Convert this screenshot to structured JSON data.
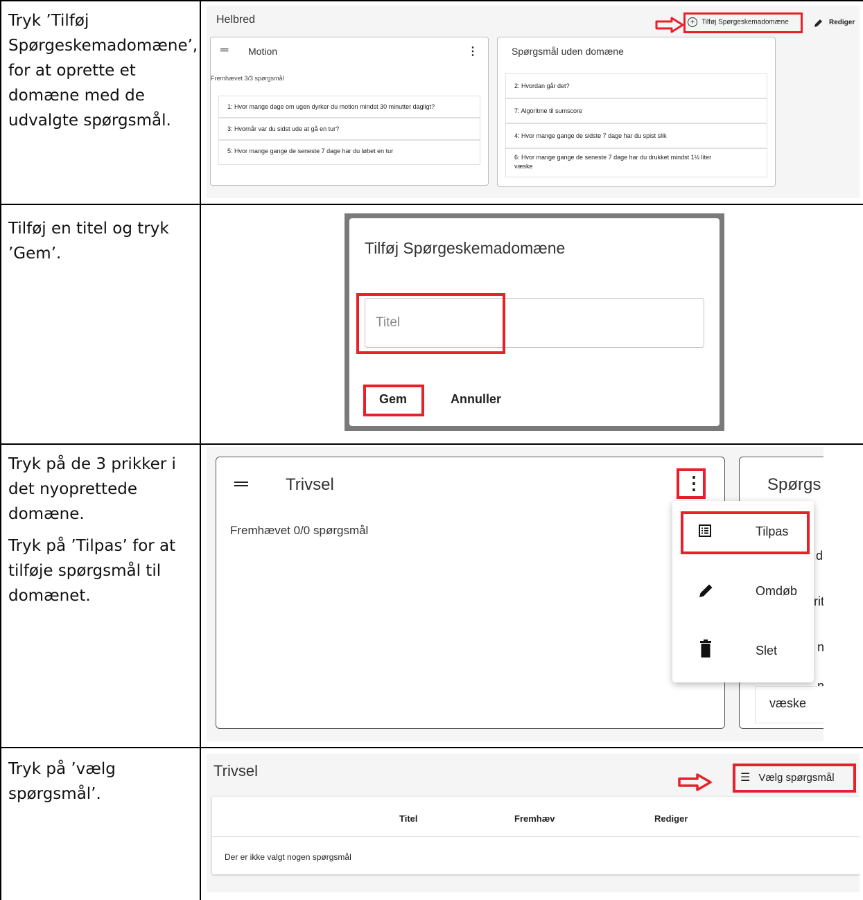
{
  "steps": [
    {
      "text": "Tryk ’Tilføj Spørgeskemadomæne’, for at oprette et domæne med de udvalgte spørgsmål."
    },
    {
      "text": "Tilføj en titel og tryk ’Gem’."
    },
    {
      "text1": "Tryk på de 3 prikker i det nyoprettede domæne.",
      "text2": "Tryk på ’Tilpas’ for at tilføje spørgsmål til domænet."
    },
    {
      "text": "Tryk på ’vælg spørgsmål’."
    }
  ],
  "shot1": {
    "heading": "Helbred",
    "add_domain_label": "Tilføj Spørgeskemadomæne",
    "edit_label": "Rediger",
    "card_motion": {
      "title": "Motion",
      "highlight": "Fremhævet 3/3 spørgsmål",
      "questions": [
        "1: Hvor mange dage om ugen dyrker du motion mindst 30 minutter dagligt?",
        "3: Hvornår var du sidst ude at gå en tur?",
        "5: Hvor mange gange de seneste 7 dage har du løbet en tur"
      ]
    },
    "card_nodomain": {
      "title": "Spørgsmål uden domæne",
      "questions": [
        "2: Hvordan går det?",
        "7: Algoritme til sumscore",
        "4: Hvor mange gange de sidste 7 dage har du spist slik",
        "6: Hvor mange gange de seneste 7 dage har du drukket mindst 1½ liter",
        "væske"
      ]
    }
  },
  "shot2": {
    "dialog_title": "Tilføj Spørgeskemadomæne",
    "title_placeholder": "Titel",
    "save_label": "Gem",
    "cancel_label": "Annuller"
  },
  "shot3": {
    "card_title": "Trivsel",
    "highlight": "Fremhævet 0/0 spørgsmål",
    "next_card_title": "Spørgs",
    "menu": [
      {
        "label": "Tilpas",
        "icon": "list-icon"
      },
      {
        "label": "Omdøb",
        "icon": "pencil-icon"
      },
      {
        "label": "Slet",
        "icon": "trash-icon"
      }
    ],
    "peek_letters": [
      "da",
      "rit",
      "n",
      "n"
    ],
    "peek_last": "væske"
  },
  "shot4": {
    "heading": "Trivsel",
    "select_label": "Vælg spørgsmål",
    "columns": [
      "Titel",
      "Fremhæv",
      "Rediger"
    ],
    "empty_text": "Der er ikke valgt nogen spørgsmål"
  },
  "colors": {
    "highlight_red": "#e8202a",
    "border": "#bdbdbd"
  }
}
